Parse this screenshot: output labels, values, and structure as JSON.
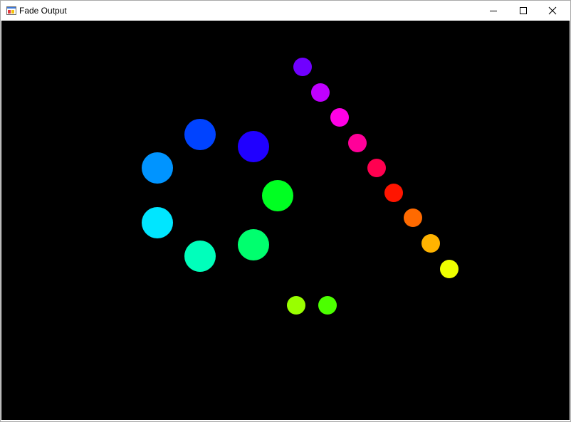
{
  "window": {
    "title": "Fade Output",
    "app_icon": "winforms-app-icon",
    "buttons": {
      "minimize_icon": "minimize-icon",
      "maximize_icon": "maximize-icon",
      "close_icon": "close-icon"
    }
  },
  "canvas": {
    "background": "#000000",
    "dots": [
      {
        "color": "#7000ff"
      },
      {
        "color": "#c000ff"
      },
      {
        "color": "#ff00e6"
      },
      {
        "color": "#ff0099"
      },
      {
        "color": "#ff0050"
      },
      {
        "color": "#ff1500"
      },
      {
        "color": "#ff6a00"
      },
      {
        "color": "#ffb300"
      },
      {
        "color": "#eeff00"
      },
      {
        "color": "#0043ff"
      },
      {
        "color": "#2000ff"
      },
      {
        "color": "#0094ff"
      },
      {
        "color": "#00ff22"
      },
      {
        "color": "#00e6ff"
      },
      {
        "color": "#00ff6e"
      },
      {
        "color": "#00ffbb"
      },
      {
        "color": "#99ff00"
      },
      {
        "color": "#4cff00"
      }
    ]
  }
}
